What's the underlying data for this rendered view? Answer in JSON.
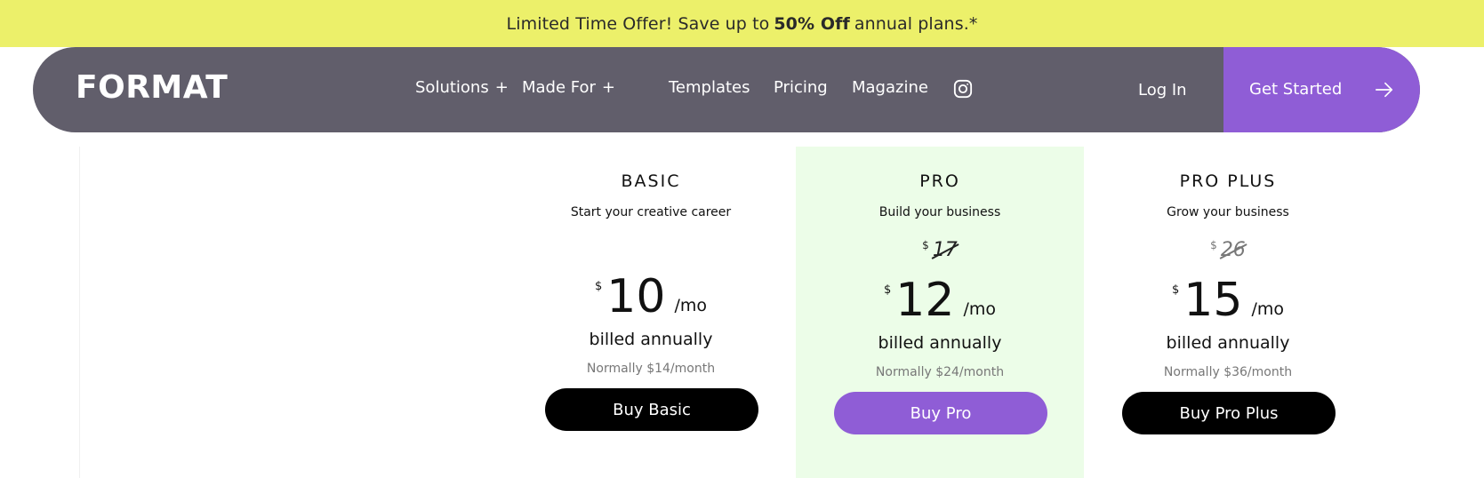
{
  "promo": {
    "before": "Limited Time Offer! Save up to",
    "bold": "50% Off",
    "after": "annual plans.*"
  },
  "nav": {
    "logo": "FORMAT",
    "items": [
      {
        "label": "Solutions",
        "suffix": "+"
      },
      {
        "label": "Made For",
        "suffix": "+"
      },
      {
        "label": "Templates"
      },
      {
        "label": "Pricing"
      },
      {
        "label": "Magazine"
      }
    ],
    "social_icon": "instagram-icon",
    "login": "Log In",
    "cta": "Get Started",
    "cta_icon": "arrow-right-icon"
  },
  "plans": [
    {
      "name": "BASIC",
      "tagline": "Start your creative career",
      "currency": "$",
      "price": "10",
      "period": "/mo",
      "billing": "billed annually",
      "normally": "Normally $14/month",
      "button": "Buy Basic"
    },
    {
      "name": "PRO",
      "tagline": "Build your business",
      "old_currency": "$",
      "old_price": "17",
      "currency": "$",
      "price": "12",
      "period": "/mo",
      "billing": "billed annually",
      "normally": "Normally $24/month",
      "button": "Buy Pro"
    },
    {
      "name": "PRO PLUS",
      "tagline": "Grow your business",
      "old_currency": "$",
      "old_price": "26",
      "currency": "$",
      "price": "15",
      "period": "/mo",
      "billing": "billed annually",
      "normally": "Normally $36/month",
      "button": "Buy Pro Plus"
    }
  ],
  "colors": {
    "promo_bg": "#ecf06a",
    "nav_bg": "#615e6b",
    "accent": "#8f5dd6",
    "highlight_bg": "#ecfde8"
  }
}
